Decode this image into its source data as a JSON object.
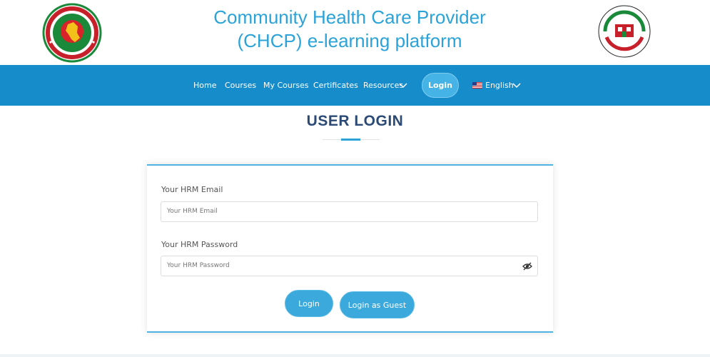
{
  "header": {
    "title_line1": "Community Health Care Provider",
    "title_line2": "(CHCP) e-learning platform"
  },
  "nav": {
    "items": [
      "Home",
      "Courses",
      "My Courses",
      "Certificates",
      "Resources"
    ],
    "login": "Login",
    "language": "English"
  },
  "login_page": {
    "heading": "USER LOGIN",
    "email_label": "Your HRM Email",
    "email_placeholder": "Your HRM Email",
    "password_label": "Your HRM Password",
    "password_placeholder": "Your HRM Password",
    "login_button": "Login",
    "guest_button": "Login as Guest"
  },
  "colors": {
    "brand_blue": "#178ccb",
    "title_blue": "#2ba3d8",
    "heading_navy": "#2b4a75",
    "button_blue": "#3ba9dc"
  }
}
